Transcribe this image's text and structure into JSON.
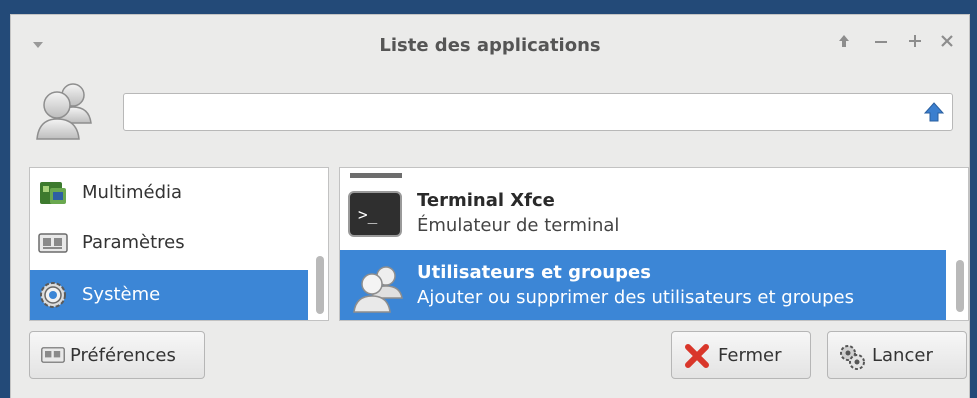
{
  "window": {
    "title": "Liste des applications",
    "controls": [
      "up",
      "minimize",
      "maximize",
      "close"
    ]
  },
  "search": {
    "value": "",
    "placeholder": ""
  },
  "categories": [
    {
      "label": "Multimédia",
      "icon": "multimedia-icon",
      "selected": false
    },
    {
      "label": "Paramètres",
      "icon": "settings-icon",
      "selected": false
    },
    {
      "label": "Système",
      "icon": "system-gear-icon",
      "selected": true
    }
  ],
  "apps": [
    {
      "name": "Terminal Xfce",
      "description": "Émulateur de terminal",
      "icon": "terminal-icon",
      "selected": false
    },
    {
      "name": "Utilisateurs et groupes",
      "description": "Ajouter ou supprimer des utilisateurs et groupes",
      "icon": "users-icon",
      "selected": true
    }
  ],
  "buttons": {
    "preferences": "Préférences",
    "close": "Fermer",
    "launch": "Lancer"
  },
  "colors": {
    "selection": "#3c86d6",
    "background": "#ebebea",
    "desktop": "#234a78"
  }
}
